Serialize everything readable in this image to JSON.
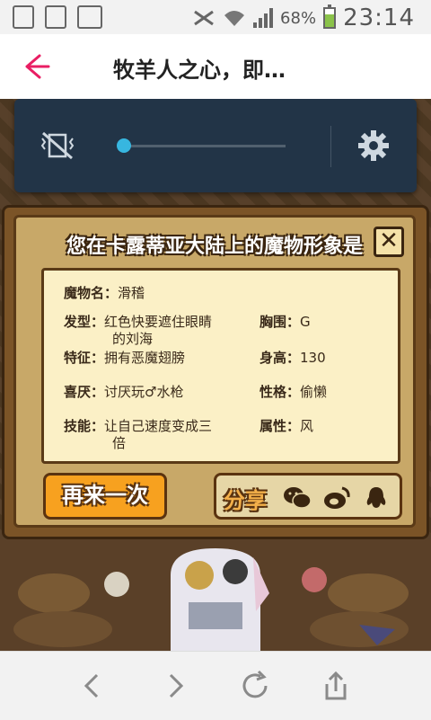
{
  "status_bar": {
    "battery_percent": "68%",
    "battery_level": 0.68,
    "time": "23:14",
    "icons": [
      "document-icon",
      "sd-card-icon",
      "image-icon",
      "mute-icon",
      "wifi-icon",
      "signal-icon",
      "battery-icon"
    ]
  },
  "titlebar": {
    "title": "牧羊人之心，即…",
    "back_icon": "back-arrow-icon"
  },
  "media_panel": {
    "mute_icon": "vibrate-off-icon",
    "volume_level": 0.0,
    "settings_icon": "gear-icon"
  },
  "result_dialog": {
    "title": "您在卡露蒂亚大陆上的魔物形象是",
    "close_label": "✕",
    "fields": {
      "monster_name_label": "魔物名：",
      "monster_name_value": "滑稽",
      "hair_label": "发型：",
      "hair_value_line1": "红色快要遮住眼睛",
      "hair_value_line2": "的刘海",
      "chest_label": "胸围：",
      "chest_value": "G",
      "feature_label": "特征：",
      "feature_value": "拥有恶魔翅膀",
      "height_label": "身高：",
      "height_value": "130",
      "dislike_label": "喜厌：",
      "dislike_value": "讨厌玩♂水枪",
      "personality_label": "性格：",
      "personality_value": "偷懒",
      "skill_label": "技能：",
      "skill_value_line1": "让自己速度变成三",
      "skill_value_line2": "倍",
      "attribute_label": "属性：",
      "attribute_value": "风"
    },
    "retry_button": "再来一次",
    "share_label": "分享",
    "share_icons": [
      "wechat-icon",
      "weibo-icon",
      "qq-icon"
    ]
  },
  "bottom_nav": {
    "icons": [
      "back-nav-icon",
      "forward-nav-icon",
      "refresh-icon",
      "share-upload-icon"
    ]
  },
  "colors": {
    "accent": "#e91e63",
    "media_bg": "#223447",
    "slider": "#37b6e0",
    "panel_bg": "#c8a868",
    "info_bg": "#fbf0c6",
    "retry_button": "#f7a11f"
  }
}
